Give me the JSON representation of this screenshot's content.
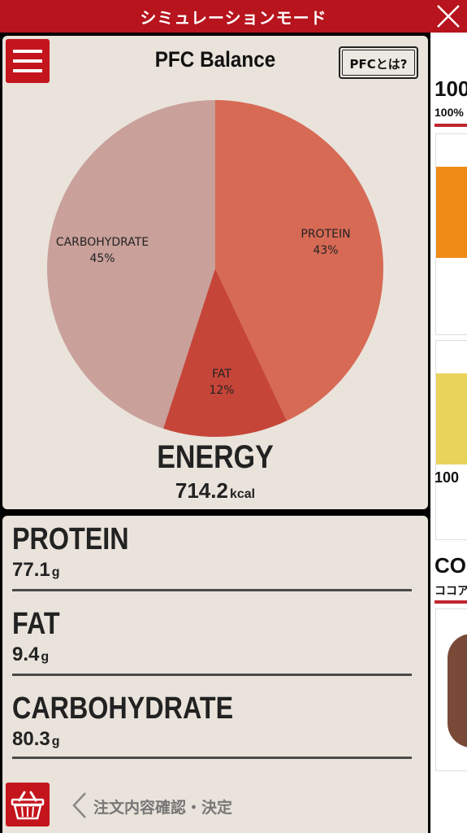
{
  "topbar": {
    "title": "シミュレーションモード"
  },
  "chart_panel": {
    "title": "PFC Balance",
    "help_button": "PFCとは?",
    "energy_label": "ENERGY",
    "energy_value": "714.2",
    "energy_unit": "kcal"
  },
  "chart_data": {
    "type": "pie",
    "slices": [
      {
        "label": "PROTEIN",
        "value": 43,
        "display": "43%",
        "color": "#d76a55"
      },
      {
        "label": "FAT",
        "value": 12,
        "display": "12%",
        "color": "#c64539"
      },
      {
        "label": "CARBOHYDRATE",
        "value": 45,
        "display": "45%",
        "color": "#c9a09a"
      }
    ]
  },
  "nutrients": [
    {
      "name": "PROTEIN",
      "value": "77.1",
      "unit": "g"
    },
    {
      "name": "FAT",
      "value": "9.4",
      "unit": "g"
    },
    {
      "name": "CARBOHYDRATE",
      "value": "80.3",
      "unit": "g"
    }
  ],
  "footer": {
    "confirm_label": "注文内容確認・決定"
  },
  "right_list": {
    "item1_head": "100",
    "item1_sub": "100%",
    "item2_head": "100",
    "item3_head": "COC",
    "item3_sub": "ココア"
  },
  "colors": {
    "brand_red": "#c4141c",
    "panel_bg": "#e9e3db"
  }
}
